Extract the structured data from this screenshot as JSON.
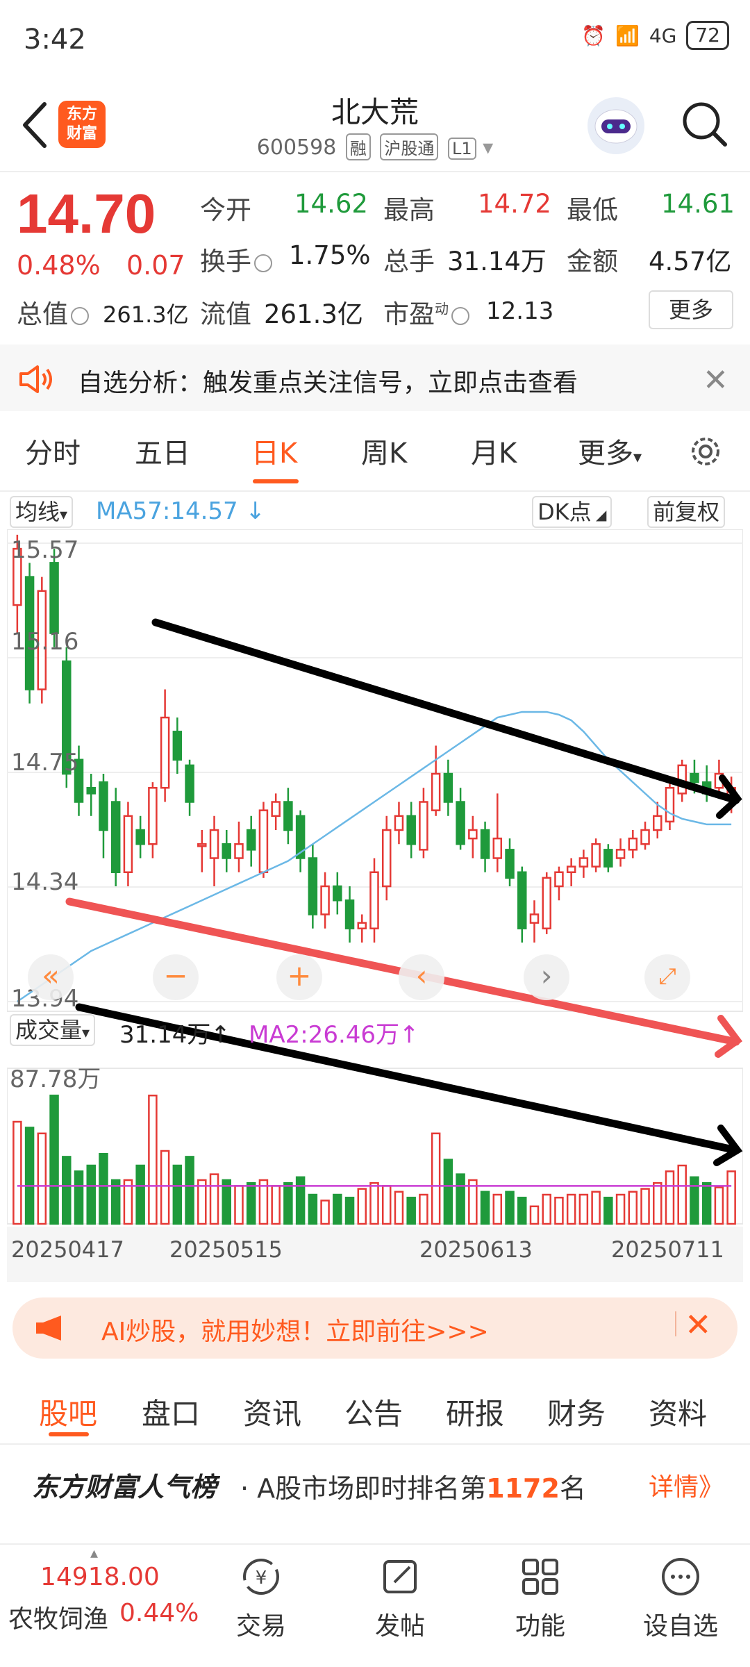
{
  "status": {
    "time": "3:42",
    "battery": "72",
    "network": "4G"
  },
  "header": {
    "logo_line1": "东方",
    "logo_line2": "财富",
    "title": "北大荒",
    "code": "600598",
    "tags": [
      "融",
      "沪股通",
      "L1"
    ]
  },
  "quote": {
    "price": "14.70",
    "pct": "0.48%",
    "change": "0.07",
    "open_label": "今开",
    "open": "14.62",
    "high_label": "最高",
    "high": "14.72",
    "low_label": "最低",
    "low": "14.61",
    "turnover_label": "换手",
    "turnover": "1.75%",
    "volume_label": "总手",
    "volume": "31.14万",
    "amount_label": "金额",
    "amount": "4.57亿",
    "mktcap_label": "总值",
    "mktcap": "261.3亿",
    "float_label": "流值",
    "float": "261.3亿",
    "pe_label": "市盈",
    "pe_sup": "动",
    "pe": "12.13",
    "more": "更多"
  },
  "banner": {
    "text": "自选分析：触发重点关注信号，立即点击查看"
  },
  "tabs": [
    "分时",
    "五日",
    "日K",
    "周K",
    "月K",
    "更多"
  ],
  "active_tab": "日K",
  "chart_controls": {
    "ma_select": "均线",
    "ma_text": "MA57:14.57 ↓",
    "dk": "DK点",
    "adjust": "前复权"
  },
  "volume_controls": {
    "label": "成交量",
    "value": "31.14万↑",
    "ma": "MA2:26.46万↑"
  },
  "colors": {
    "up": "#e53935",
    "down": "#1f9a3b",
    "accent": "#ff5a1f",
    "ma": "#4aa3df",
    "vol_ma": "#c93bd3"
  },
  "chart_data": {
    "type": "candlestick",
    "price_ticks": [
      "15.57",
      "15.16",
      "14.75",
      "14.34",
      "13.94"
    ],
    "volume_max_label": "87.78万",
    "dates": [
      "20250417",
      "20250515",
      "20250613",
      "20250711"
    ],
    "ylim": [
      13.94,
      15.57
    ],
    "candles": [
      [
        15.35,
        15.55,
        15.6,
        15.25
      ],
      [
        15.45,
        15.05,
        15.5,
        15.0
      ],
      [
        15.05,
        15.4,
        15.45,
        15.0
      ],
      [
        15.5,
        15.25,
        15.55,
        15.2
      ],
      [
        15.15,
        14.75,
        15.2,
        14.7
      ],
      [
        14.8,
        14.65,
        14.85,
        14.6
      ],
      [
        14.7,
        14.68,
        14.75,
        14.6
      ],
      [
        14.72,
        14.55,
        14.75,
        14.45
      ],
      [
        14.65,
        14.4,
        14.7,
        14.35
      ],
      [
        14.4,
        14.6,
        14.65,
        14.35
      ],
      [
        14.55,
        14.5,
        14.6,
        14.45
      ],
      [
        14.5,
        14.7,
        14.72,
        14.45
      ],
      [
        14.7,
        14.95,
        15.05,
        14.65
      ],
      [
        14.9,
        14.8,
        14.95,
        14.75
      ],
      [
        14.78,
        14.65,
        14.8,
        14.6
      ],
      [
        14.5,
        14.5,
        14.55,
        14.4
      ],
      [
        14.45,
        14.55,
        14.6,
        14.35
      ],
      [
        14.5,
        14.45,
        14.55,
        14.4
      ],
      [
        14.45,
        14.5,
        14.58,
        14.4
      ],
      [
        14.55,
        14.48,
        14.6,
        14.42
      ],
      [
        14.4,
        14.62,
        14.65,
        14.38
      ],
      [
        14.6,
        14.65,
        14.68,
        14.55
      ],
      [
        14.65,
        14.55,
        14.7,
        14.5
      ],
      [
        14.6,
        14.45,
        14.62,
        14.4
      ],
      [
        14.45,
        14.25,
        14.5,
        14.2
      ],
      [
        14.25,
        14.35,
        14.4,
        14.2
      ],
      [
        14.35,
        14.3,
        14.4,
        14.25
      ],
      [
        14.3,
        14.2,
        14.35,
        14.15
      ],
      [
        14.2,
        14.22,
        14.25,
        14.15
      ],
      [
        14.2,
        14.4,
        14.45,
        14.15
      ],
      [
        14.35,
        14.55,
        14.6,
        14.3
      ],
      [
        14.55,
        14.6,
        14.65,
        14.5
      ],
      [
        14.6,
        14.5,
        14.65,
        14.45
      ],
      [
        14.48,
        14.65,
        14.7,
        14.45
      ],
      [
        14.62,
        14.75,
        14.85,
        14.6
      ],
      [
        14.75,
        14.65,
        14.8,
        14.6
      ],
      [
        14.65,
        14.5,
        14.7,
        14.48
      ],
      [
        14.52,
        14.55,
        14.6,
        14.45
      ],
      [
        14.55,
        14.45,
        14.58,
        14.4
      ],
      [
        14.45,
        14.52,
        14.68,
        14.4
      ],
      [
        14.48,
        14.38,
        14.52,
        14.35
      ],
      [
        14.4,
        14.2,
        14.42,
        14.15
      ],
      [
        14.22,
        14.25,
        14.3,
        14.15
      ],
      [
        14.2,
        14.38,
        14.4,
        14.18
      ],
      [
        14.35,
        14.4,
        14.42,
        14.3
      ],
      [
        14.4,
        14.42,
        14.45,
        14.35
      ],
      [
        14.42,
        14.45,
        14.48,
        14.38
      ],
      [
        14.42,
        14.5,
        14.52,
        14.4
      ],
      [
        14.48,
        14.42,
        14.5,
        14.4
      ],
      [
        14.45,
        14.48,
        14.52,
        14.42
      ],
      [
        14.48,
        14.52,
        14.55,
        14.45
      ],
      [
        14.5,
        14.55,
        14.58,
        14.48
      ],
      [
        14.55,
        14.6,
        14.65,
        14.52
      ],
      [
        14.58,
        14.7,
        14.72,
        14.55
      ],
      [
        14.68,
        14.78,
        14.8,
        14.65
      ],
      [
        14.75,
        14.72,
        14.8,
        14.68
      ],
      [
        14.72,
        14.68,
        14.78,
        14.65
      ],
      [
        14.7,
        14.75,
        14.8,
        14.68
      ],
      [
        14.66,
        14.7,
        14.74,
        14.61
      ]
    ],
    "ma": [
      13.94,
      13.97,
      14.0,
      14.03,
      14.06,
      14.09,
      14.12,
      14.14,
      14.16,
      14.18,
      14.2,
      14.22,
      14.24,
      14.26,
      14.28,
      14.3,
      14.32,
      14.34,
      14.36,
      14.38,
      14.4,
      14.42,
      14.44,
      14.47,
      14.5,
      14.53,
      14.56,
      14.59,
      14.62,
      14.65,
      14.68,
      14.71,
      14.74,
      14.77,
      14.8,
      14.83,
      14.86,
      14.89,
      14.92,
      14.95,
      14.96,
      14.97,
      14.97,
      14.97,
      14.96,
      14.94,
      14.9,
      14.85,
      14.8,
      14.76,
      14.72,
      14.68,
      14.64,
      14.61,
      14.59,
      14.58,
      14.57,
      14.57,
      14.57
    ],
    "volume": [
      0.7,
      0.66,
      0.62,
      0.88,
      0.46,
      0.36,
      0.4,
      0.48,
      0.3,
      0.3,
      0.4,
      0.88,
      0.5,
      0.4,
      0.46,
      0.3,
      0.34,
      0.3,
      0.26,
      0.28,
      0.3,
      0.26,
      0.28,
      0.32,
      0.2,
      0.16,
      0.2,
      0.18,
      0.24,
      0.28,
      0.26,
      0.22,
      0.18,
      0.2,
      0.62,
      0.44,
      0.34,
      0.3,
      0.22,
      0.2,
      0.22,
      0.18,
      0.12,
      0.2,
      0.18,
      0.2,
      0.2,
      0.22,
      0.18,
      0.2,
      0.22,
      0.24,
      0.28,
      0.36,
      0.4,
      0.32,
      0.28,
      0.25,
      0.36
    ],
    "vol_ma": [
      0.26,
      0.26,
      0.26,
      0.26,
      0.26,
      0.26,
      0.26,
      0.26,
      0.26,
      0.26,
      0.26,
      0.26,
      0.26,
      0.26,
      0.26,
      0.26,
      0.26,
      0.26,
      0.26,
      0.26,
      0.26,
      0.26,
      0.26,
      0.26,
      0.26,
      0.26,
      0.26,
      0.26,
      0.26,
      0.26,
      0.26,
      0.26,
      0.26,
      0.26,
      0.26,
      0.26,
      0.26,
      0.26,
      0.26,
      0.26,
      0.26,
      0.26,
      0.26,
      0.26,
      0.26,
      0.26,
      0.26,
      0.26,
      0.26,
      0.26,
      0.26,
      0.26,
      0.26,
      0.26,
      0.26,
      0.26,
      0.26,
      0.26,
      0.26
    ]
  },
  "ai_banner": {
    "text": "AI炒股，就用妙想！立即前往>>>"
  },
  "sub_tabs": [
    "股吧",
    "盘口",
    "资讯",
    "公告",
    "研报",
    "财务",
    "资料"
  ],
  "popularity": {
    "title": "东方财富人气榜",
    "text_before": "· A股市场即时排名第",
    "rank": "1172",
    "text_after": "名",
    "detail": "详情》"
  },
  "bottom": {
    "index_value": "14918.00",
    "index_name": "农牧饲渔",
    "index_pct": "0.44%",
    "items": [
      "交易",
      "发帖",
      "功能",
      "设自选"
    ]
  }
}
